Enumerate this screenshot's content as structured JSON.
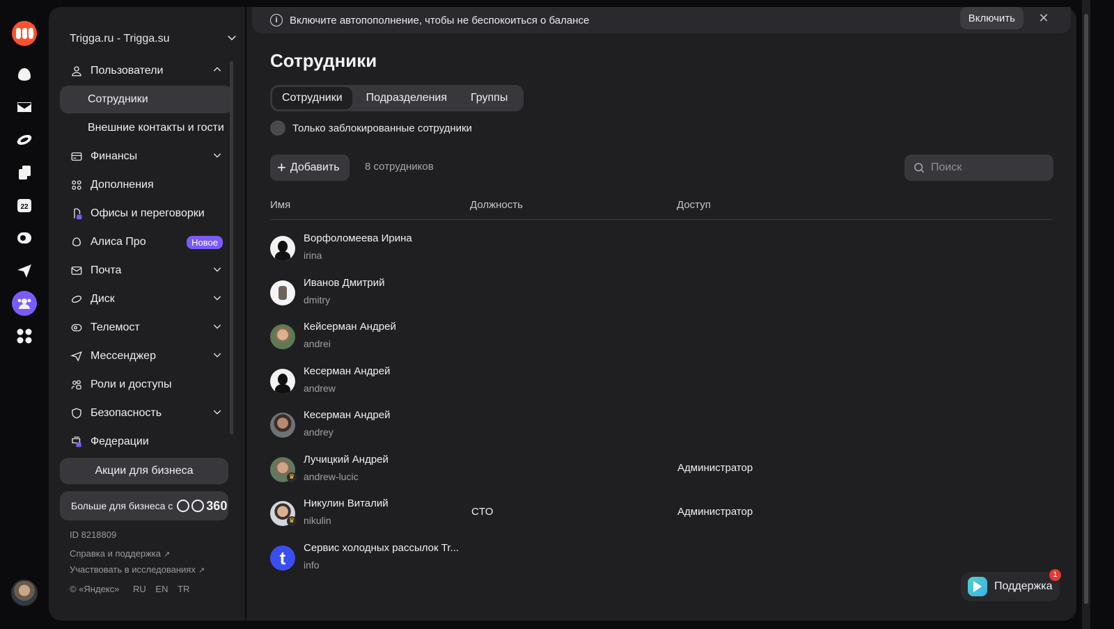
{
  "rail": {
    "icons": [
      "yandex360-logo",
      "alice-icon",
      "mail-icon",
      "disk-icon",
      "documents-icon",
      "calendar-icon",
      "telemost-icon",
      "messenger-icon",
      "admin-icon",
      "apps-icon"
    ],
    "calendar_day": "22"
  },
  "sidebar": {
    "org_name": "Trigga.ru - Trigga.su",
    "items": [
      {
        "label": "Пользователи",
        "icon": "user-icon",
        "expandable": true,
        "expanded": true
      },
      {
        "label": "Сотрудники",
        "sub": true,
        "selected": true
      },
      {
        "label": "Внешние контакты и гости",
        "sub": true
      },
      {
        "label": "Финансы",
        "icon": "card-icon",
        "expandable": true
      },
      {
        "label": "Дополнения",
        "icon": "grid-icon"
      },
      {
        "label": "Офисы и переговорки",
        "icon": "office-icon"
      },
      {
        "label": "Алиса Про",
        "icon": "alice-icon",
        "badge": "Новое"
      },
      {
        "label": "Почта",
        "icon": "mail-icon",
        "expandable": true
      },
      {
        "label": "Диск",
        "icon": "disk-icon",
        "expandable": true
      },
      {
        "label": "Телемост",
        "icon": "telemost-icon",
        "expandable": true
      },
      {
        "label": "Мессенджер",
        "icon": "messenger-icon",
        "expandable": true
      },
      {
        "label": "Роли и доступы",
        "icon": "roles-icon"
      },
      {
        "label": "Безопасность",
        "icon": "shield-icon",
        "expandable": true
      },
      {
        "label": "Федерации",
        "icon": "federation-icon"
      }
    ],
    "promo_business": "Акции для бизнеса",
    "promo_more": "Больше для бизнеса с",
    "promo_brand_number": "360",
    "org_id": "ID 8218809",
    "help_link": "Справка и поддержка",
    "research_link": "Участвовать в исследованиях",
    "copyright": "© «Яндекс»",
    "languages": [
      "RU",
      "EN",
      "TR"
    ]
  },
  "banner": {
    "text": "Включите автопополнение, чтобы не беспокоиться о балансе",
    "button": "Включить",
    "close": "✕"
  },
  "main": {
    "title": "Сотрудники",
    "tabs": [
      {
        "label": "Сотрудники",
        "active": true
      },
      {
        "label": "Подразделения",
        "active": false
      },
      {
        "label": "Группы",
        "active": false
      }
    ],
    "blocked_only_label": "Только заблокированные сотрудники",
    "add_button": "Добавить",
    "count_text": "8 сотрудников",
    "search_placeholder": "Поиск",
    "columns": {
      "name": "Имя",
      "position": "Должность",
      "access": "Доступ"
    },
    "employees": [
      {
        "name": "Ворфоломеева Ирина",
        "login": "irina",
        "position": "",
        "access": "",
        "avatar": "silhouette"
      },
      {
        "name": "Иванов Дмитрий",
        "login": "dmitry",
        "position": "",
        "access": "",
        "avatar": "robot"
      },
      {
        "name": "Кейсерман Андрей",
        "login": "andrei",
        "position": "",
        "access": "",
        "avatar": "photo1"
      },
      {
        "name": "Кесерман Андрей",
        "login": "andrew",
        "position": "",
        "access": "",
        "avatar": "silhouette"
      },
      {
        "name": "Кесерман Андрей",
        "login": "andrey",
        "position": "",
        "access": "",
        "avatar": "photo2"
      },
      {
        "name": "Лучицкий Андрей",
        "login": "andrew-lucic",
        "position": "",
        "access": "Администратор",
        "avatar": "photo3",
        "admin": true
      },
      {
        "name": "Никулин Виталий",
        "login": "nikulin",
        "position": "CTO",
        "access": "Администратор",
        "avatar": "photo4",
        "admin": true
      },
      {
        "name": "Сервис холодных рассылок Tr...",
        "login": "info",
        "position": "",
        "access": "",
        "avatar": "letter",
        "letter": "t"
      }
    ]
  },
  "support": {
    "label": "Поддержка",
    "notifications": "1"
  }
}
